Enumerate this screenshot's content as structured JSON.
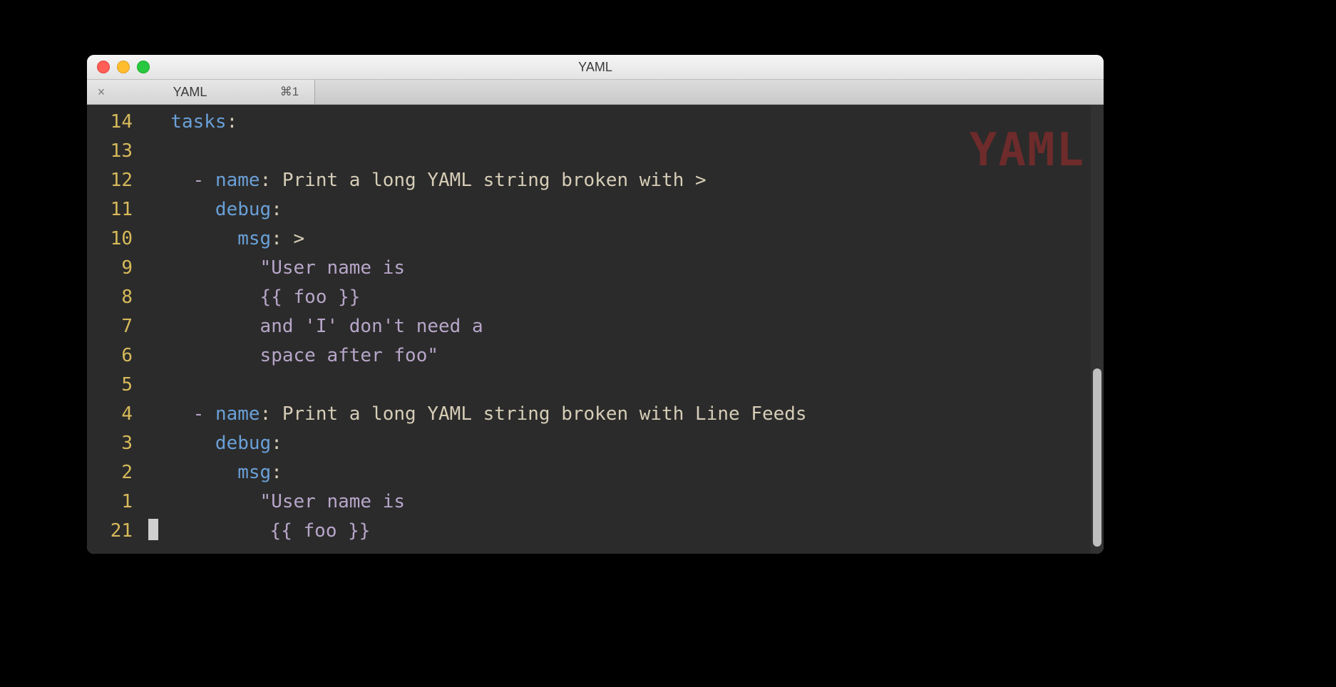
{
  "window": {
    "title": "YAML"
  },
  "tabs": [
    {
      "title": "YAML",
      "shortcut": "⌘1"
    }
  ],
  "watermark": "YAML",
  "gutter": [
    "14",
    "13",
    "12",
    "11",
    "10",
    "9",
    "8",
    "7",
    "6",
    "5",
    "4",
    "3",
    "2",
    "1",
    "21"
  ],
  "code": {
    "lines": [
      {
        "indent": "  ",
        "key": "tasks",
        "colon": ":",
        "rest": ""
      },
      {
        "indent": "",
        "key": "",
        "colon": "",
        "rest": ""
      },
      {
        "indent": "    ",
        "dash": "- ",
        "key": "name",
        "colon": ": ",
        "rest": "Print a long YAML string broken with >"
      },
      {
        "indent": "      ",
        "key": "debug",
        "colon": ":",
        "rest": ""
      },
      {
        "indent": "        ",
        "key": "msg",
        "colon": ": ",
        "rest": ">"
      },
      {
        "indent": "          ",
        "str": "\"User name is"
      },
      {
        "indent": "          ",
        "str": "{{ foo }}"
      },
      {
        "indent": "          ",
        "str": "and 'I' don't need a"
      },
      {
        "indent": "          ",
        "str": "space after foo\""
      },
      {
        "indent": "",
        "key": "",
        "colon": "",
        "rest": ""
      },
      {
        "indent": "    ",
        "dash": "- ",
        "key": "name",
        "colon": ": ",
        "rest": "Print a long YAML string broken with Line Feeds"
      },
      {
        "indent": "      ",
        "key": "debug",
        "colon": ":",
        "rest": ""
      },
      {
        "indent": "        ",
        "key": "msg",
        "colon": ":",
        "rest": ""
      },
      {
        "indent": "          ",
        "str": "\"User name is"
      },
      {
        "indent": "           ",
        "str": "{{ foo }}",
        "cursor": true
      }
    ]
  }
}
